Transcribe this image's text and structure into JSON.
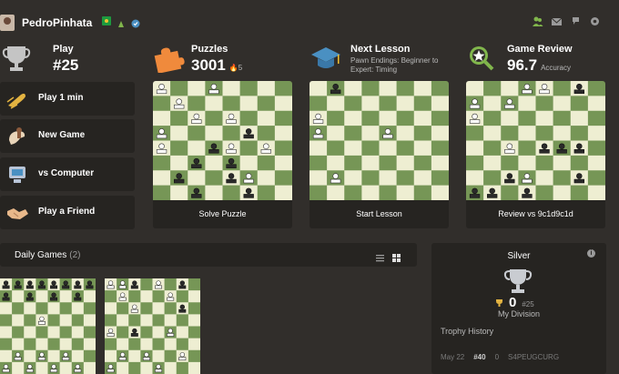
{
  "header": {
    "username": "PedroPinhata",
    "icons": [
      "flag-icon",
      "leaf-icon",
      "verified-icon"
    ],
    "right_icons": [
      "friends-icon",
      "messages-icon",
      "help-icon",
      "settings-icon"
    ]
  },
  "stats": {
    "play": {
      "label": "Play",
      "value": "#25"
    },
    "puzzles": {
      "label": "Puzzles",
      "value": "3001",
      "streak": "5"
    },
    "lesson": {
      "label": "Next Lesson",
      "subtitle": "Pawn Endings: Beginner to Expert: Timing"
    },
    "review": {
      "label": "Game Review",
      "value": "96.7",
      "unit": "Accuracy"
    }
  },
  "actions": [
    {
      "label": "Play 1 min",
      "icon": "bullet-icon"
    },
    {
      "label": "New Game",
      "icon": "hand-pawn-icon"
    },
    {
      "label": "vs Computer",
      "icon": "computer-icon"
    },
    {
      "label": "Play a Friend",
      "icon": "handshake-icon"
    }
  ],
  "boards": [
    {
      "button": "Solve Puzzle"
    },
    {
      "button": "Start Lesson"
    },
    {
      "button": "Review vs 9c1d9c1d"
    }
  ],
  "daily": {
    "title": "Daily Games",
    "count": "(2)"
  },
  "league": {
    "title": "Silver",
    "score": "0",
    "rank": "#25",
    "division": "My Division",
    "history_title": "Trophy History",
    "history": {
      "date": "May 22",
      "rank": "#40",
      "score": "0",
      "opponent": "S4PEUGCURG"
    }
  },
  "colors": {
    "background": "#312e2b",
    "card": "#262421",
    "light_square": "#eeeed2",
    "dark_square": "#769656",
    "accent": "#81b64c"
  }
}
